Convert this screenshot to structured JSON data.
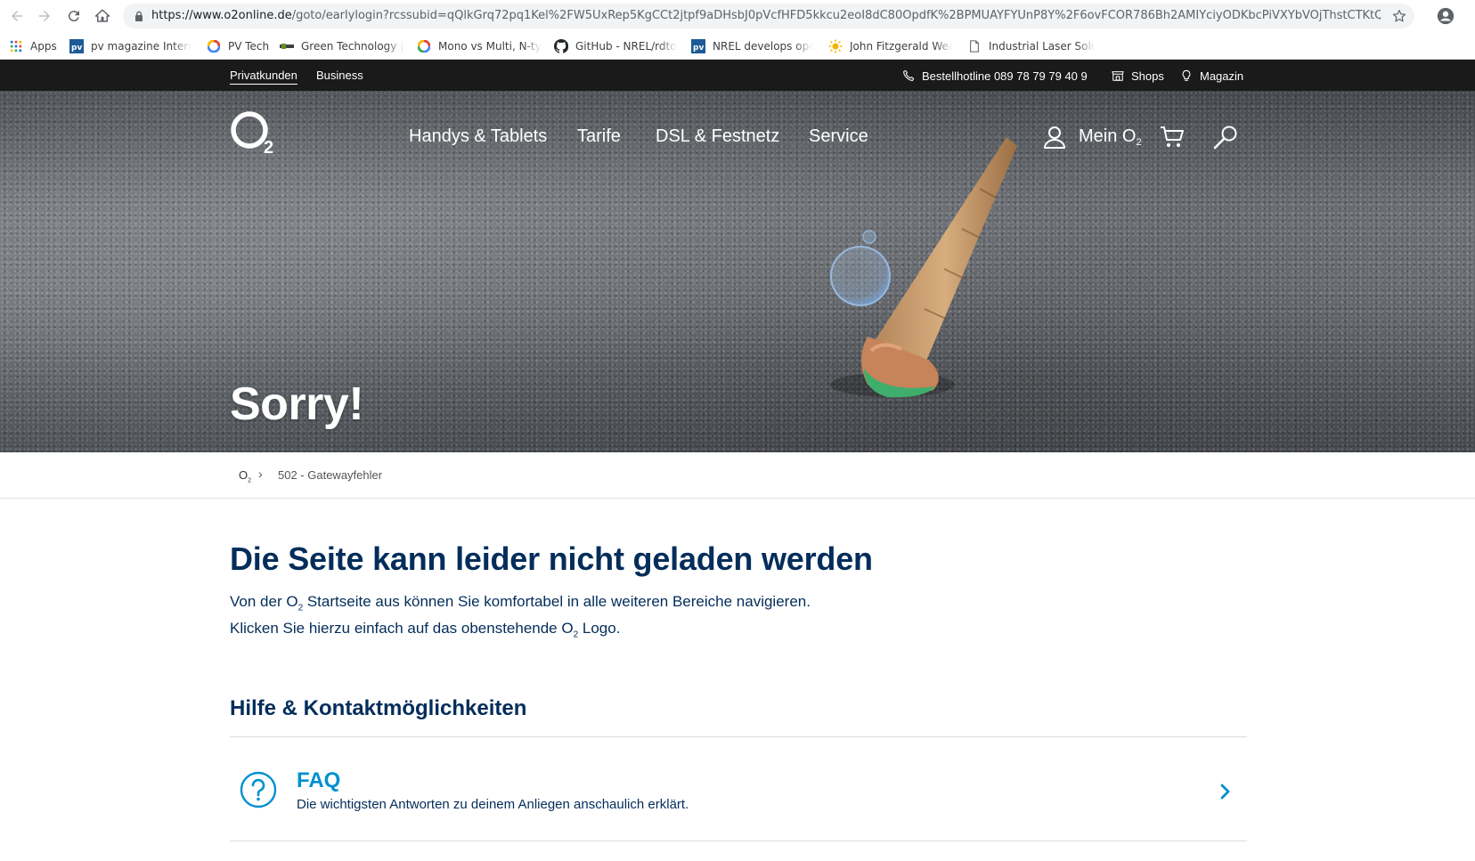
{
  "browser": {
    "url_domain": "https://www.o2online.de",
    "url_path": "/goto/earlylogin?rcssubid=qQlkGrq72pq1Kel%2FW5UxRep5KgCCt2jtpf9aDHsbJ0pVcfHFD5kkcu2eoI8dC80OpdfK%2BPMUAYFYUnP8Y%2F6ovFCOR786Bh2AMIYciyODKbcPiVXYbVOjThstCTKtQTfC",
    "icons": [
      "back-icon",
      "forward-icon",
      "reload-icon",
      "home-icon",
      "lock-icon",
      "star-icon",
      "profile-icon"
    ],
    "bookmarks": [
      {
        "label": "Apps",
        "icon": "apps-grid-icon"
      },
      {
        "label": "pv magazine Internat",
        "icon": "pv-magazine-icon"
      },
      {
        "label": "PV Tech",
        "icon": "pvtech-icon"
      },
      {
        "label": "Green Technology | C",
        "icon": "green-tech-icon"
      },
      {
        "label": "Mono vs Multi, N-typ",
        "icon": "google-icon"
      },
      {
        "label": "GitHub - NREL/rdtoo",
        "icon": "github-icon"
      },
      {
        "label": "NREL develops open",
        "icon": "pv-magazine-icon"
      },
      {
        "label": "John Fitzgerald Weav",
        "icon": "sun-icon"
      },
      {
        "label": "Industrial Laser Solut",
        "icon": "page-icon"
      }
    ]
  },
  "topbar": {
    "links": [
      "Privatkunden",
      "Business"
    ],
    "hotline": "Bestellhotline 089 78 79 79 40 9",
    "shops": "Shops",
    "magazin": "Magazin"
  },
  "header": {
    "logo_text": "O",
    "logo_sub": "2",
    "nav": [
      "Handys & Tablets",
      "Tarife",
      "DSL & Festnetz",
      "Service"
    ],
    "mein_label": "Mein O",
    "mein_sub": "2",
    "icons": [
      "user-icon",
      "cart-icon",
      "search-icon"
    ]
  },
  "hero": {
    "title": "Sorry!"
  },
  "breadcrumb": {
    "home": "O",
    "home_sub": "2",
    "separator": "›",
    "current": "502 - Gatewayfehler"
  },
  "content": {
    "headline": "Die Seite kann leider nicht geladen werden",
    "line1_a": "Von der O",
    "line1_sub": "2",
    "line1_b": " Startseite aus können Sie komfortabel in alle weiteren Bereiche navigieren.",
    "line2_a": "Klicken Sie hierzu einfach auf das obenstehende O",
    "line2_sub": "2",
    "line2_b": " Logo.",
    "section_title": "Hilfe & Kontaktmöglichkeiten",
    "faq": {
      "title": "FAQ",
      "description": "Die wichtigsten Antworten zu deinem Anliegen anschaulich erklärt.",
      "icon": "question-circle-icon"
    }
  },
  "colors": {
    "primary_navy": "#032d5a",
    "accent_blue": "#0090d0",
    "topbar_bg": "#1a1a1a"
  }
}
